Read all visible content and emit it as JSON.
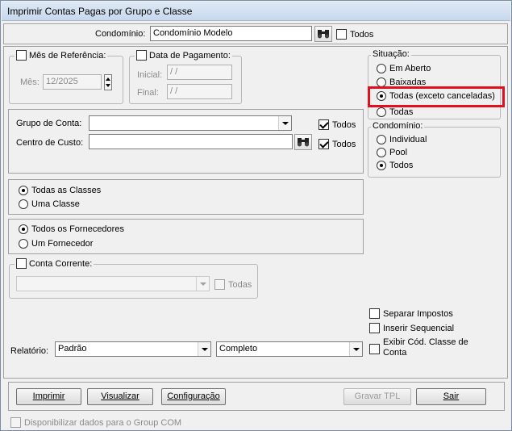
{
  "window": {
    "title": "Imprimir Contas Pagas por Grupo e Classe"
  },
  "condominio_row": {
    "label": "Condomínio:",
    "value": "Condomínio Modelo",
    "todos_label": "Todos",
    "todos_checked": false
  },
  "mes_referencia": {
    "label": "Mês de Referência:",
    "checked": false,
    "mes_label": "Mês:",
    "mes_value": "12/2025"
  },
  "data_pagamento": {
    "label": "Data de Pagamento:",
    "checked": false,
    "inicial_label": "Inicial:",
    "inicial_value": " / /",
    "final_label": "Final:",
    "final_value": " / /"
  },
  "situacao": {
    "label": "Situação:",
    "options": [
      "Em Aberto",
      "Baixadas",
      "Todas (exceto canceladas)",
      "Todas"
    ],
    "selected": "Todas (exceto canceladas)"
  },
  "condominio_tipo": {
    "label": "Condomínio:",
    "options": [
      "Individual",
      "Pool",
      "Todos"
    ],
    "selected": "Todos"
  },
  "grupo_conta": {
    "label": "Grupo de Conta:",
    "value": "",
    "todos_label": "Todos",
    "todos_checked": true
  },
  "centro_custo": {
    "label": "Centro de Custo:",
    "value": "",
    "todos_label": "Todos",
    "todos_checked": true
  },
  "classes": {
    "options": [
      "Todas as Classes",
      "Uma Classe"
    ],
    "selected": "Todas as Classes"
  },
  "fornecedores": {
    "options": [
      "Todos os Fornecedores",
      "Um Fornecedor"
    ],
    "selected": "Todos os Fornecedores"
  },
  "conta_corrente": {
    "label": "Conta Corrente:",
    "checked": false,
    "value": "",
    "todas_label": "Todas"
  },
  "opcoes": {
    "separar_impostos": "Separar Impostos",
    "inserir_sequencial": "Inserir Sequencial",
    "exibir_cod_line1": "Exibir Cód. Classe de",
    "exibir_cod_line2": "Conta"
  },
  "relatorio": {
    "label": "Relatório:",
    "modelo": "Padrão",
    "tipo": "Completo"
  },
  "buttons": {
    "imprimir": "Imprimir",
    "visualizar": "Visualizar",
    "configuracao": "Configuração",
    "gravar_tpl": "Gravar TPL",
    "sair": "Sair"
  },
  "footer": {
    "group_com": "Disponibilizar dados para o Group COM"
  },
  "colors": {
    "highlight": "#e0101e",
    "window_bg": "#f0f0f0"
  }
}
